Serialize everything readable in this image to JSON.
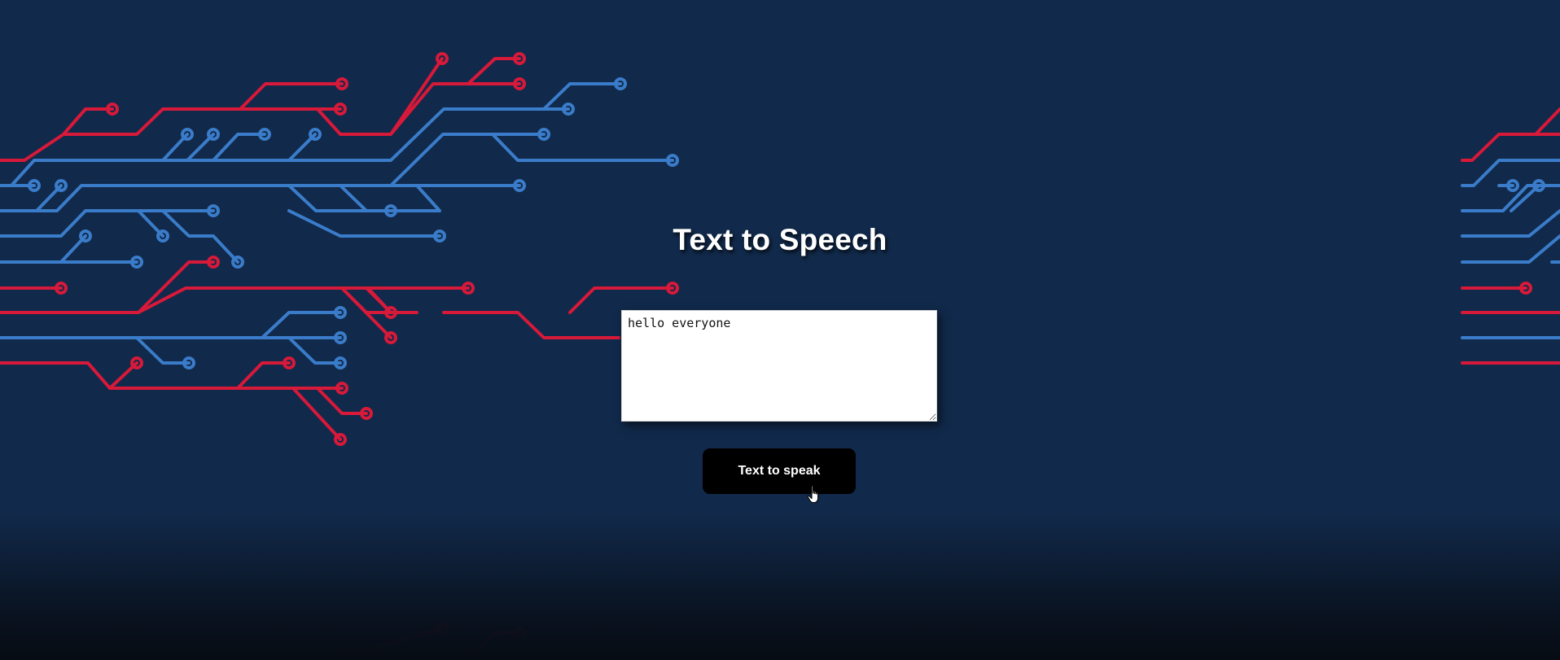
{
  "page": {
    "title": "Text to Speech"
  },
  "input": {
    "value": "hello everyone",
    "placeholder": ""
  },
  "button": {
    "label": "Text to speak"
  },
  "icons": {
    "circuit_left": "circuit-pattern-icon",
    "circuit_right": "circuit-pattern-icon",
    "cursor": "hand-pointer-icon"
  },
  "colors": {
    "background": "#11294a",
    "circuit_red": "#d7193a",
    "circuit_blue": "#3a7cc9",
    "button_bg": "#000000",
    "button_text": "#ffffff",
    "title_text": "#ffffff"
  }
}
